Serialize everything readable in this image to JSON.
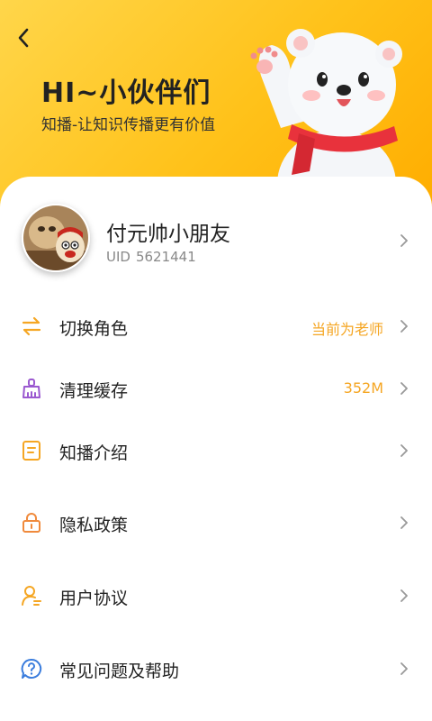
{
  "header": {
    "title": "HI~小伙伴们",
    "subtitle": "知播-让知识传播更有价值",
    "back_icon": "chevron-left-icon",
    "mascot": "polar-bear-mascot-waving-red-scarf"
  },
  "profile": {
    "name": "付元帅小朋友",
    "uid_label": "UID",
    "uid_value": "5621441"
  },
  "menu": [
    {
      "label": "切换角色",
      "value": "当前为老师",
      "icon": "swap-arrows-icon",
      "icon_color": "#f5a623"
    },
    {
      "label": "清理缓存",
      "value": "352M",
      "icon": "broom-clean-icon",
      "icon_color": "#9b59d0"
    },
    {
      "label": "知播介绍",
      "value": "",
      "icon": "document-icon",
      "icon_color": "#f5a623"
    },
    {
      "label": "隐私政策",
      "value": "",
      "icon": "lock-icon",
      "icon_color": "#f08a3c"
    },
    {
      "label": "用户协议",
      "value": "",
      "icon": "user-agreement-icon",
      "icon_color": "#f5a623"
    },
    {
      "label": "常见问题及帮助",
      "value": "",
      "icon": "help-question-icon",
      "icon_color": "#3b7ddd"
    }
  ],
  "colors": {
    "accent": "#f5a623",
    "header_gradient_start": "#ffd64a",
    "header_gradient_end": "#ffad00"
  }
}
